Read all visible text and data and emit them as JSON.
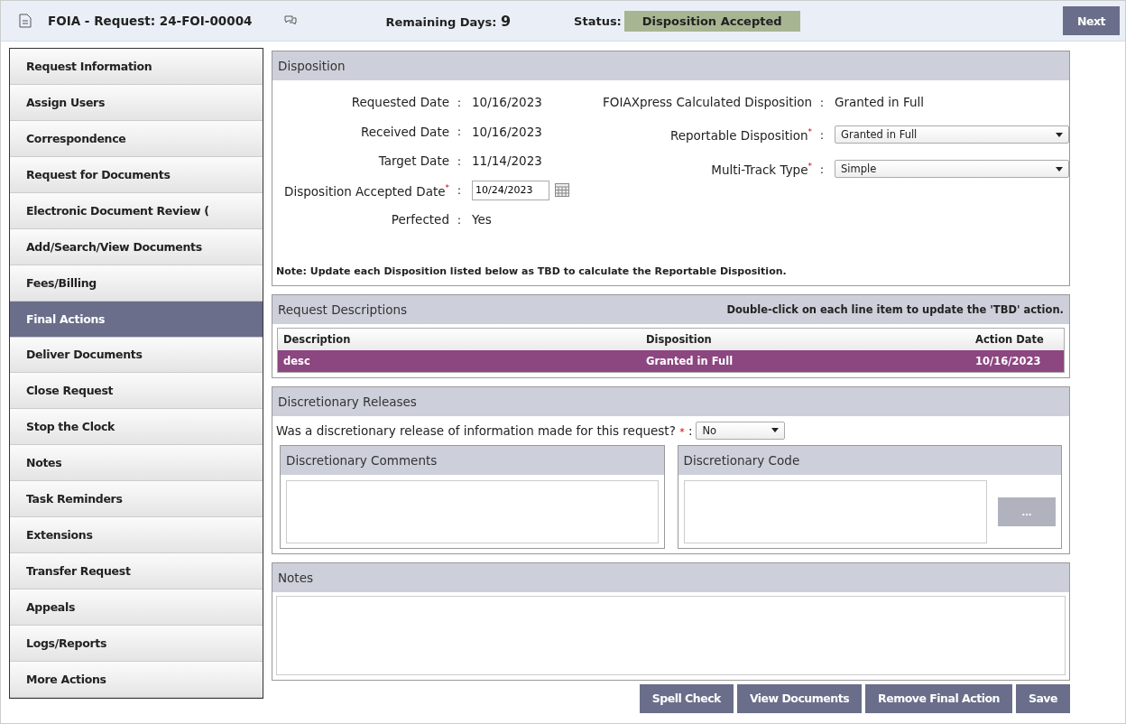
{
  "header": {
    "title": "FOIA - Request: 24-FOI-00004",
    "remaining_label": "Remaining Days:",
    "remaining_value": "9",
    "status_label": "Status:",
    "status_value": "Disposition Accepted",
    "next_button": "Next"
  },
  "sidebar": {
    "items": [
      {
        "label": "Request Information",
        "selected": false
      },
      {
        "label": "Assign Users",
        "selected": false
      },
      {
        "label": "Correspondence",
        "selected": false
      },
      {
        "label": "Request for Documents",
        "selected": false
      },
      {
        "label": "Electronic Document Review (",
        "selected": false
      },
      {
        "label": "Add/Search/View Documents",
        "selected": false
      },
      {
        "label": "Fees/Billing",
        "selected": false
      },
      {
        "label": "Final Actions",
        "selected": true
      },
      {
        "label": "Deliver Documents",
        "selected": false
      },
      {
        "label": "Close Request",
        "selected": false
      },
      {
        "label": "Stop the Clock",
        "selected": false
      },
      {
        "label": "Notes",
        "selected": false
      },
      {
        "label": "Task Reminders",
        "selected": false
      },
      {
        "label": "Extensions",
        "selected": false
      },
      {
        "label": "Transfer Request",
        "selected": false
      },
      {
        "label": "Appeals",
        "selected": false
      },
      {
        "label": "Logs/Reports",
        "selected": false
      },
      {
        "label": "More Actions",
        "selected": false
      }
    ]
  },
  "disposition": {
    "title": "Disposition",
    "left_fields": [
      {
        "kind": "text",
        "label": "Requested Date",
        "colon": ":",
        "value": "10/16/2023"
      },
      {
        "kind": "text",
        "label": "Received Date",
        "colon": ":",
        "value": "10/16/2023"
      },
      {
        "kind": "text",
        "label": "Target Date",
        "colon": ":",
        "value": "11/14/2023"
      },
      {
        "kind": "date",
        "label": "Disposition Accepted Date",
        "required": "*",
        "colon": ":",
        "value": "10/24/2023"
      },
      {
        "kind": "text",
        "label": "Perfected",
        "colon": ":",
        "value": "Yes"
      }
    ],
    "right_fields": [
      {
        "kind": "text",
        "label": "FOIAXpress Calculated Disposition",
        "colon": ":",
        "value": "Granted in Full"
      },
      {
        "kind": "select",
        "label": "Reportable Disposition",
        "required": "*",
        "colon": ":",
        "value": "Granted in Full"
      },
      {
        "kind": "select",
        "label": "Multi-Track Type",
        "required": "*",
        "colon": ":",
        "value": "Simple"
      }
    ],
    "note": "Note: Update each Disposition listed below as TBD to calculate the Reportable Disposition."
  },
  "request_descriptions": {
    "title": "Request Descriptions",
    "hint": "Double-click on each line item to update the 'TBD' action.",
    "table": {
      "columns": [
        "Description",
        "Disposition",
        "Action Date"
      ],
      "rows": [
        {
          "cells": [
            "desc",
            "Granted in Full",
            "10/16/2023"
          ],
          "selected": true
        }
      ]
    }
  },
  "discretionary_releases": {
    "title": "Discretionary Releases",
    "question": "Was a discretionary release of information made for this request?",
    "required": "*",
    "colon": ":",
    "answer": "No",
    "comments": {
      "title": "Discretionary Comments"
    },
    "code": {
      "title": "Discretionary Code",
      "button": "..."
    }
  },
  "notes": {
    "title": "Notes"
  },
  "buttons": [
    "Spell Check",
    "View Documents",
    "Remove Final Action",
    "Save"
  ]
}
